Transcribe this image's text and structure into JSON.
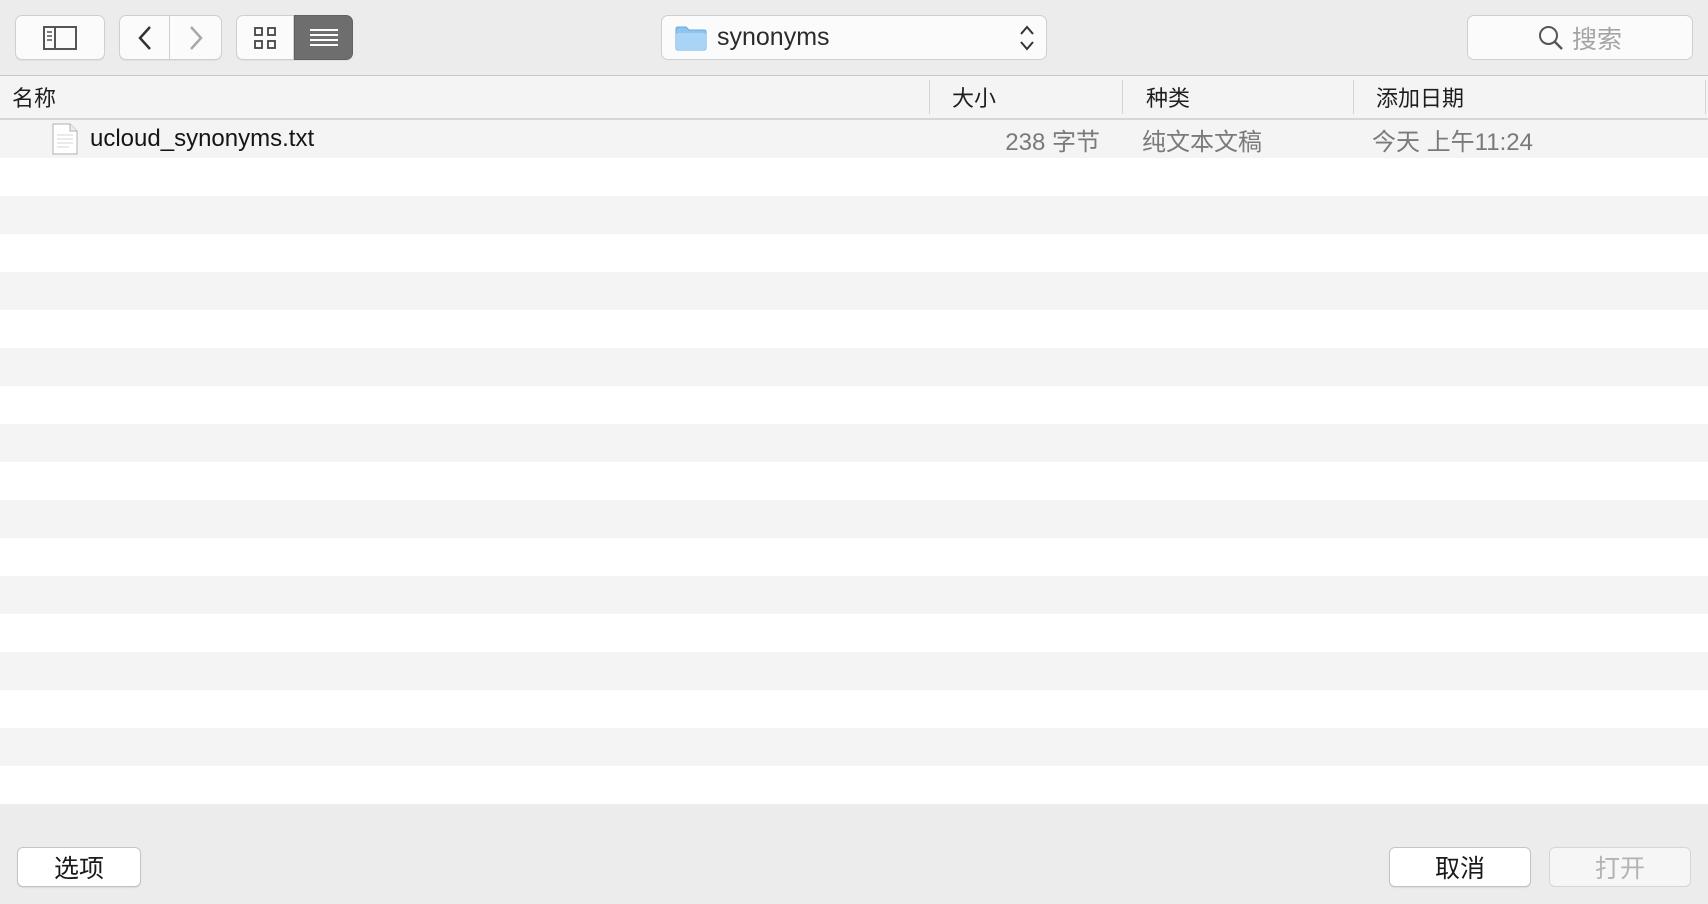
{
  "toolbar": {
    "path_popup": {
      "label": "synonyms",
      "icon": "folder-icon"
    },
    "search": {
      "placeholder": "搜索"
    }
  },
  "columns": {
    "name": "名称",
    "size": "大小",
    "kind": "种类",
    "date_added": "添加日期"
  },
  "files": [
    {
      "name": "ucloud_synonyms.txt",
      "size": "238 字节",
      "kind": "纯文本文稿",
      "date_added": "今天 上午11:24"
    }
  ],
  "buttons": {
    "options": "选项",
    "cancel": "取消",
    "open": "打开"
  },
  "colors": {
    "folder": "#8cc4ef",
    "active_segment": "#6e6e6e",
    "row_alt": "#f4f4f4"
  }
}
